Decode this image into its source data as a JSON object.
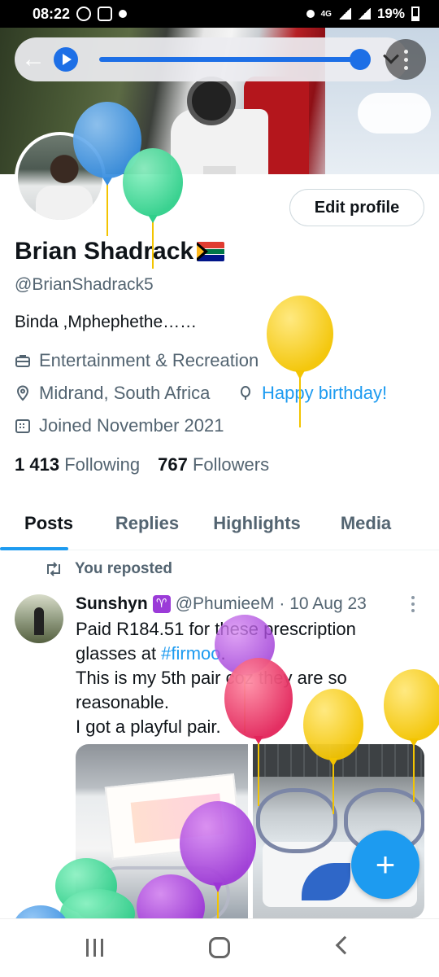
{
  "status_bar": {
    "time": "08:22",
    "network": "4G",
    "battery": "19%"
  },
  "media_player": {
    "progress": 0.95
  },
  "profile": {
    "edit_button": "Edit profile",
    "name": "Brian Shadrack",
    "flag_icon": "south-africa-flag-emoji",
    "handle": "@BrianShadrack5",
    "bio": "Binda ,Mphephethe……",
    "category": "Entertainment & Recreation",
    "location": "Midrand, South Africa",
    "birthday": "Happy birthday!",
    "joined": "Joined November 2021",
    "following_count": "1 413",
    "following_label": "Following",
    "followers_count": "767",
    "followers_label": "Followers"
  },
  "tabs": [
    {
      "label": "Posts",
      "active": true
    },
    {
      "label": "Replies",
      "active": false
    },
    {
      "label": "Highlights",
      "active": false
    },
    {
      "label": "Media",
      "active": false
    }
  ],
  "tweet": {
    "repost_label": "You reposted",
    "author_name": "Sunshyn",
    "author_badge": "♈",
    "author_handle": "@PhumieeM",
    "date": "· 10 Aug 23",
    "line1": "Paid R184.51 for these prescription",
    "line2_pre": "glasses at ",
    "hashtag": "#firmoo",
    "line2_post": ".",
    "line3": "This is my 5th pair coz they are so",
    "line4": "reasonable.",
    "line5": "I got a playful pair."
  },
  "fab_label": "+",
  "colors": {
    "accent": "#1d9bf0",
    "text_primary": "#0f1419",
    "text_secondary": "#536471"
  }
}
